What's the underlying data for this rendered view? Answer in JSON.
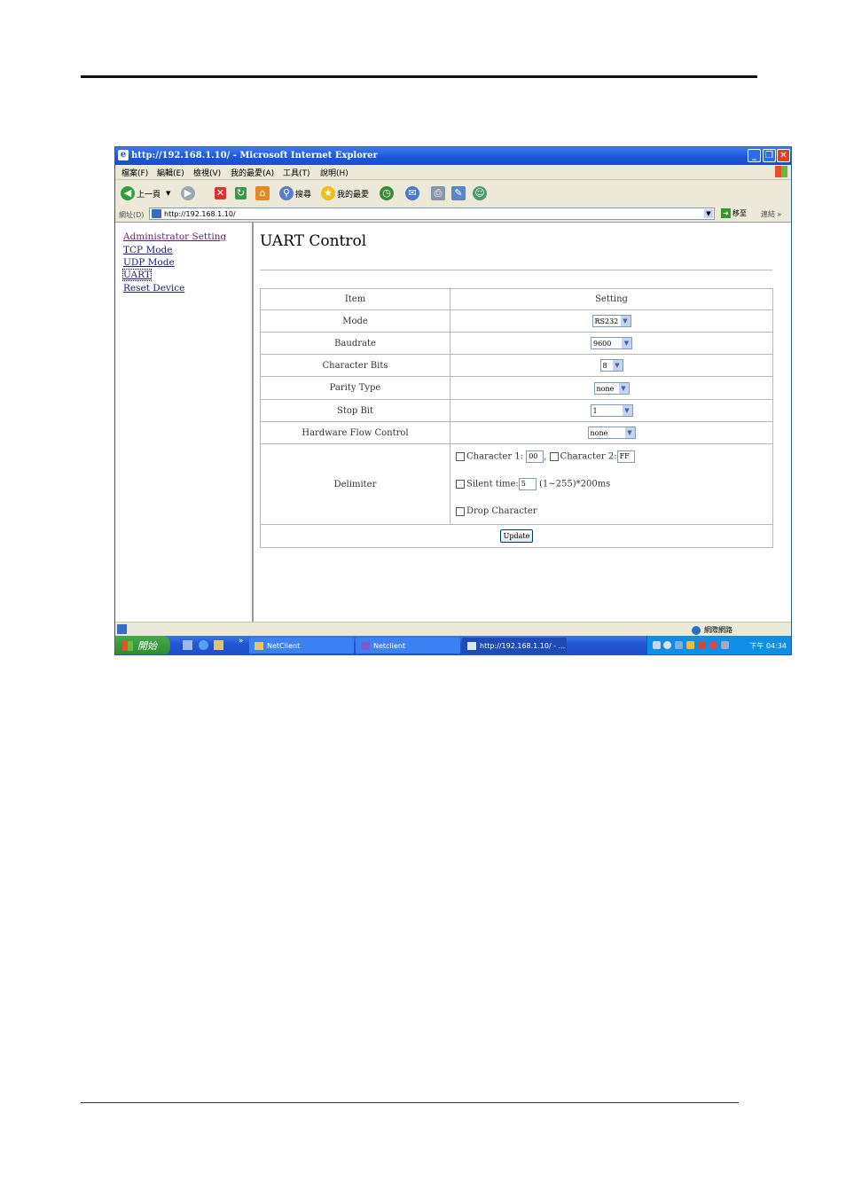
{
  "window": {
    "title": "http://192.168.1.10/ - Microsoft Internet Explorer",
    "min_glyph": "_",
    "max_glyph": "❐",
    "close_glyph": "✕"
  },
  "menubar": [
    "檔案(F)",
    "編輯(E)",
    "檢視(V)",
    "我的最愛(A)",
    "工具(T)",
    "說明(H)"
  ],
  "toolbar": {
    "back_label": "上一頁",
    "search_label": "搜尋",
    "favorites_label": "我的最愛"
  },
  "address": {
    "label": "網址(D)",
    "url": "http://192.168.1.10/",
    "go_label": "移至",
    "links_label": "連結",
    "more": "»"
  },
  "nav": {
    "links": [
      "Administrator Setting",
      "TCP Mode",
      "UDP Mode",
      "UART",
      "Reset Device"
    ]
  },
  "page": {
    "title": "UART Control"
  },
  "table": {
    "headers": {
      "item": "Item",
      "setting": "Setting"
    },
    "rows": [
      {
        "item": "Mode",
        "value": "RS232"
      },
      {
        "item": "Baudrate",
        "value": "9600"
      },
      {
        "item": "Character Bits",
        "value": "8"
      },
      {
        "item": "Parity Type",
        "value": "none"
      },
      {
        "item": "Stop Bit",
        "value": "1"
      },
      {
        "item": "Hardware Flow Control",
        "value": "none"
      }
    ],
    "delimiter": {
      "label": "Delimiter",
      "char1_label": "Character 1:",
      "char1_value": "00",
      "separator": ",",
      "char2_label": "Character 2:",
      "char2_value": "FF",
      "silent_label": "Silent time:",
      "silent_value": "5",
      "silent_units": "(1~255)*200ms",
      "drop_label": "Drop Character"
    },
    "update_label": "Update"
  },
  "statusbar": {
    "zone": "網際網路"
  },
  "taskbar": {
    "start": "開始",
    "tasks": [
      "NetClient",
      "Netclient",
      "http://192.168.1.10/ - ..."
    ],
    "clock": "下午 04:34",
    "chevron": "»"
  },
  "colors": {
    "titlebar": "#1b55d6",
    "taskbar": "#2357d3",
    "link": "#1a1a7a",
    "visited": "#6a1a6a"
  }
}
